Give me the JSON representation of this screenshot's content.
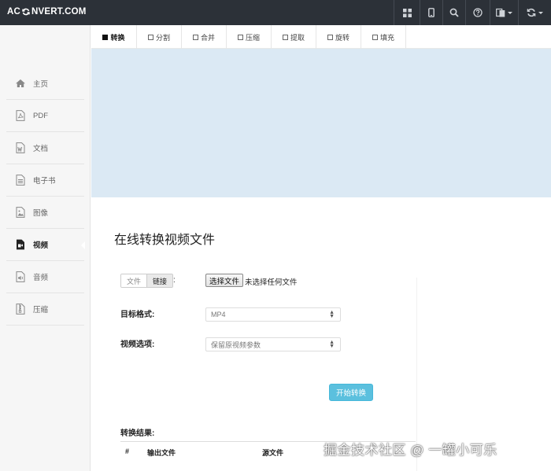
{
  "brand": {
    "logo_left": "AC",
    "logo_right": "NVERT.COM"
  },
  "topnav": {
    "icons": [
      "grid-icon",
      "mobile-icon",
      "search-icon",
      "help-icon",
      "language-icon",
      "refresh-icon"
    ]
  },
  "sidebar": {
    "items": [
      {
        "label": "主页",
        "icon": "home-icon"
      },
      {
        "label": "PDF",
        "icon": "pdf-file-icon"
      },
      {
        "label": "文档",
        "icon": "word-file-icon"
      },
      {
        "label": "电子书",
        "icon": "ebook-icon"
      },
      {
        "label": "图像",
        "icon": "image-icon"
      },
      {
        "label": "视频",
        "icon": "video-icon",
        "active": true
      },
      {
        "label": "音频",
        "icon": "audio-icon"
      },
      {
        "label": "压缩",
        "icon": "archive-icon"
      }
    ]
  },
  "tabs": [
    "转换",
    "分割",
    "合并",
    "压缩",
    "提取",
    "旋转",
    "填充"
  ],
  "main": {
    "title": "在线转换视频文件",
    "source_segment": {
      "file": "文件",
      "link": "链接",
      "colon": ":"
    },
    "file_button": "选择文件",
    "no_file": "未选择任何文件",
    "target_label": "目标格式:",
    "target_value": "MP4",
    "options_label": "视频选项:",
    "options_value": "保留原视频参数",
    "start_button": "开始转换",
    "result_label": "转换结果:",
    "table_headers": [
      "#",
      "输出文件",
      "源文件"
    ]
  },
  "watermark": "掘金技术社区 @ 一罐小可乐",
  "colors": {
    "topbar": "#2c3138",
    "banner": "#dbe9f4",
    "button": "#5bc0de"
  }
}
